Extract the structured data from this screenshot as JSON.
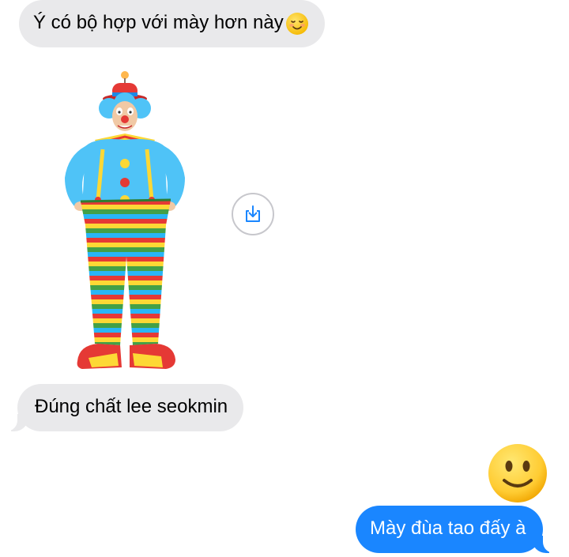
{
  "messages": [
    {
      "direction": "received",
      "text": "Ý có bộ hợp với mày hơn này",
      "trailing_emoji": "smiling-face-icon"
    },
    {
      "direction": "received",
      "type": "image",
      "image_subject": "clown-costume-icon",
      "action_icon": "download-icon"
    },
    {
      "direction": "received",
      "text": "Đúng chất lee seokmin"
    },
    {
      "direction": "sent",
      "type": "emoji",
      "emoji": "slightly-smiling-face-icon"
    },
    {
      "direction": "sent",
      "text": "Mày đùa tao đấy à"
    }
  ],
  "colors": {
    "received_bubble": "#e9e9eb",
    "sent_bubble": "#1a86ff",
    "received_text": "#000000",
    "sent_text": "#ffffff",
    "emoji_yellow": "#ffcc33"
  }
}
